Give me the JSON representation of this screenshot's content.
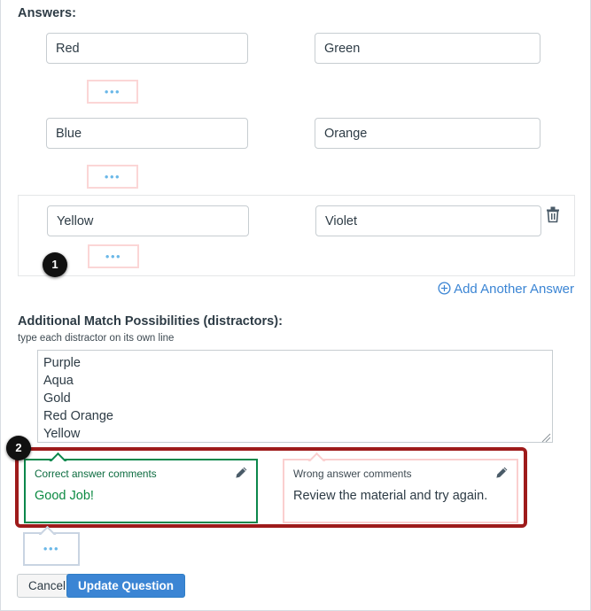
{
  "section": {
    "answers_heading": "Answers:"
  },
  "answers": [
    {
      "left": "Red",
      "right": "Green",
      "stub_dots": "•••",
      "has_trash": false,
      "bordered": false
    },
    {
      "left": "Blue",
      "right": "Orange",
      "stub_dots": "•••",
      "has_trash": false,
      "bordered": false
    },
    {
      "left": "Yellow",
      "right": "Violet",
      "stub_dots": "•••",
      "has_trash": true,
      "bordered": true
    }
  ],
  "add_answer": {
    "label": "Add Another Answer",
    "icon": "circle-plus-icon",
    "color": "#3b85d4"
  },
  "distractors": {
    "label": "Additional Match Possibilities (distractors):",
    "hint": "type each distractor on its own line",
    "value": "Purple\nAqua\nGold\nRed Orange\nYellow",
    "lines": [
      "Purple",
      "Aqua",
      "Gold",
      "Red Orange",
      "Yellow"
    ]
  },
  "comments": {
    "correct": {
      "title": "Correct answer comments",
      "text": "Good Job!",
      "border_color": "#0b874b",
      "edit_icon": "pencil-icon"
    },
    "wrong": {
      "title": "Wrong answer comments",
      "text": "Review the material and try again.",
      "border_color": "#fbcfcf",
      "edit_icon": "pencil-icon"
    },
    "general_stub_dots": "•••"
  },
  "highlight": {
    "color": "#9e1b1b"
  },
  "markers": [
    {
      "number": "1"
    },
    {
      "number": "2"
    }
  ],
  "footer": {
    "cancel_label": "Cancel",
    "update_label": "Update Question"
  },
  "icons": {
    "trash": "trash-icon",
    "pencil": "pencil-icon",
    "resize": "resize-grip-icon"
  }
}
